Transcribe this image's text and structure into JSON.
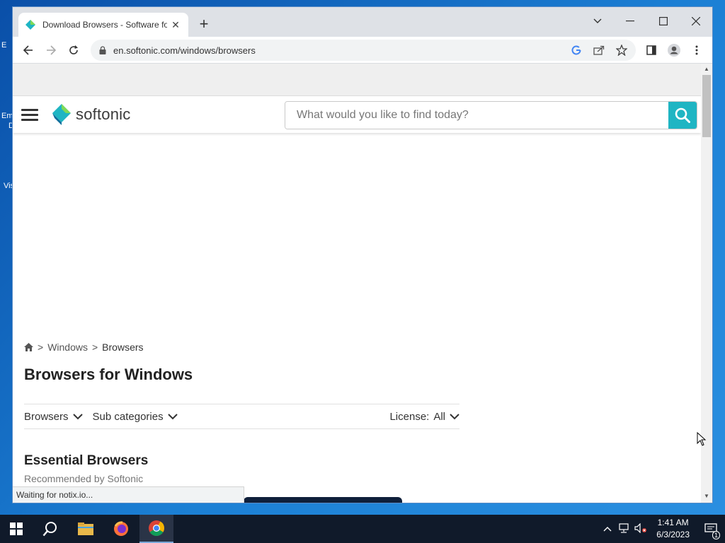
{
  "desktop": {
    "icon_labels": [
      "E",
      "Em",
      "D",
      "Vis"
    ]
  },
  "browser": {
    "tab_title": "Download Browsers - Software fo",
    "url": "en.softonic.com/windows/browsers",
    "status_text": "Waiting for notix.io..."
  },
  "site": {
    "logo_text": "softonic",
    "search_placeholder": "What would you like to find today?",
    "accent_color": "#1fb5c3"
  },
  "breadcrumb": {
    "separator": ">",
    "items": [
      "Windows",
      "Browsers"
    ]
  },
  "page": {
    "title": "Browsers for Windows",
    "filters": {
      "category": "Browsers",
      "subcategories": "Sub categories",
      "license_label": "License:",
      "license_value": "All"
    },
    "section_title": "Essential Browsers",
    "section_subtitle": "Recommended by Softonic"
  },
  "taskbar": {
    "time": "1:41 AM",
    "date": "6/3/2023",
    "notification_count": "1"
  }
}
